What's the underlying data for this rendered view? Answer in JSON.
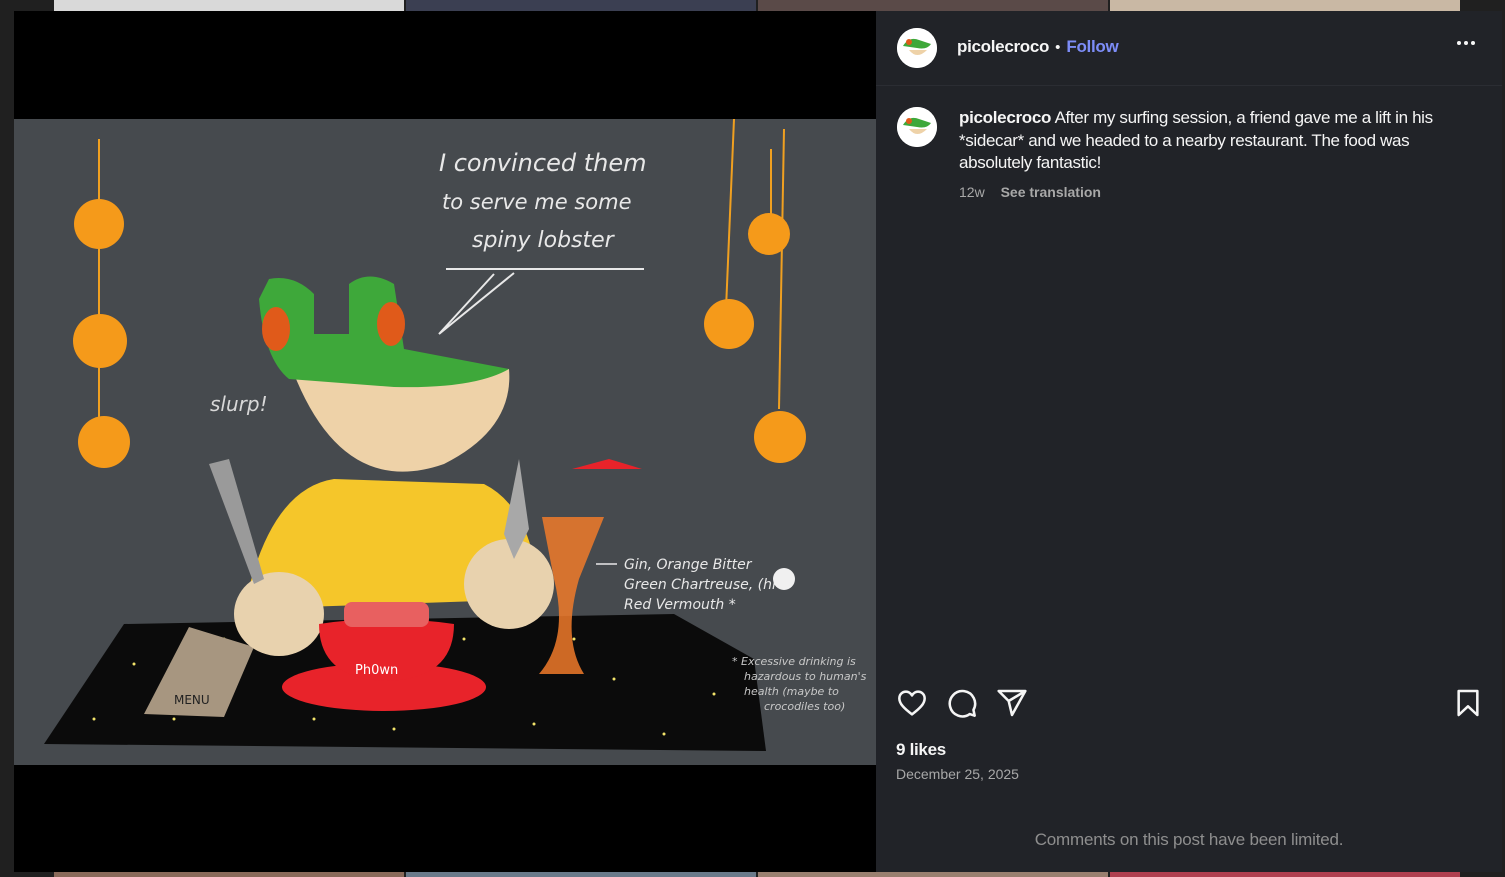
{
  "post": {
    "username": "picolecroco",
    "follow_label": "Follow",
    "separator": "•",
    "caption_username": "picolecroco",
    "caption_text": "After my surfing session, a friend gave me a lift in his *sidecar* and we headed to a nearby restaurant. The food was absolutely fantastic!",
    "age": "12w",
    "see_translation": "See translation",
    "likes": "9 likes",
    "date": "December 25, 2025",
    "comments_limited": "Comments on this post have been limited."
  },
  "artwork": {
    "speech_line1": "I convinced  them",
    "speech_line2": "to  serve  me  some",
    "speech_line3": "spiny  lobster",
    "slurp": "slurp!",
    "drink_line1": "Gin, Orange  Bitter",
    "drink_line2": "Green  Chartreuse,  (hi",
    "drink_line3": "Red  Vermouth  *",
    "bowl_label": "Ph0wn",
    "menu_label": "MENU",
    "disclaimer_line1": "* Excessive drinking is",
    "disclaimer_line2": "hazardous to human's",
    "disclaimer_line3": "health (maybe to",
    "disclaimer_line4": "crocodiles  too)"
  },
  "icons": {
    "more": "more-options-icon",
    "like": "heart-icon",
    "comment": "comment-icon",
    "share": "send-icon",
    "save": "bookmark-icon"
  },
  "colors": {
    "panel_bg": "#212328",
    "follow": "#7d8df8",
    "artwork_bg": "#464a4e"
  }
}
